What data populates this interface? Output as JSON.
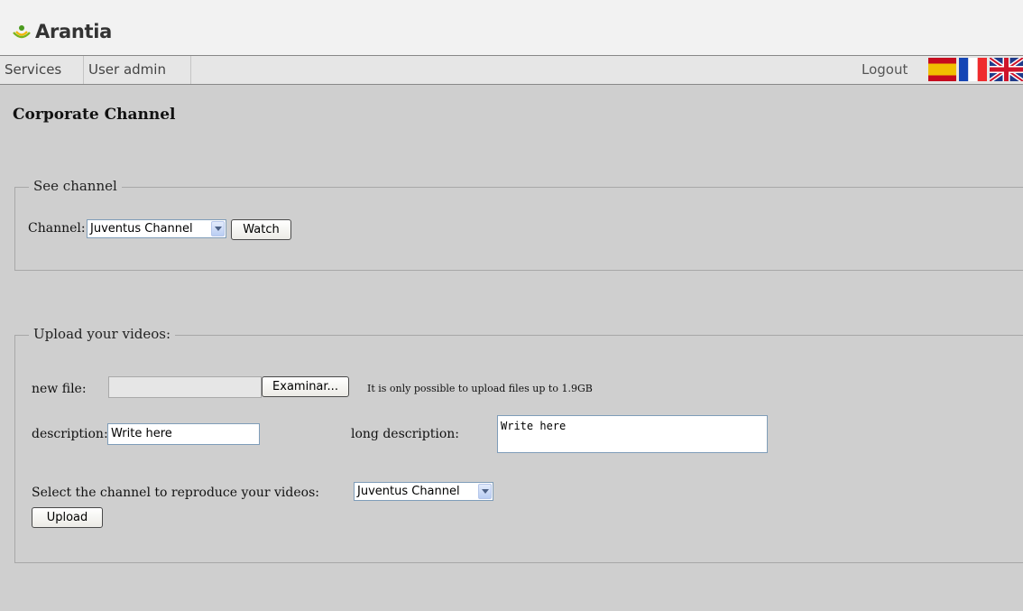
{
  "header": {
    "logo_text": "Arantia"
  },
  "nav": {
    "services": "Services",
    "user_admin": "User admin",
    "logout": "Logout",
    "flags": [
      "spanish-flag",
      "french-flag",
      "uk-flag"
    ]
  },
  "page": {
    "title": "Corporate Channel"
  },
  "see_channel": {
    "legend": "See channel",
    "channel_label": "Channel:",
    "channel_selected": "Juventus Channel",
    "watch_button": "Watch"
  },
  "upload": {
    "legend": "Upload your videos:",
    "new_file_label": "new file:",
    "browse_button": "Examinar...",
    "size_note": "It is only possible to upload files up to 1.9GB",
    "description_label": "description:",
    "description_value": "Write here",
    "long_description_label": "long description:",
    "long_description_value": "Write here",
    "channel_select_label": "Select the channel to reproduce your videos:",
    "channel_selected": "Juventus Channel",
    "upload_button": "Upload"
  },
  "colors": {
    "background": "#cfcfcf",
    "header_bg": "#f2f2f2",
    "navbar_bg": "#e6e6e6",
    "logo_green": "#7ab51d"
  }
}
